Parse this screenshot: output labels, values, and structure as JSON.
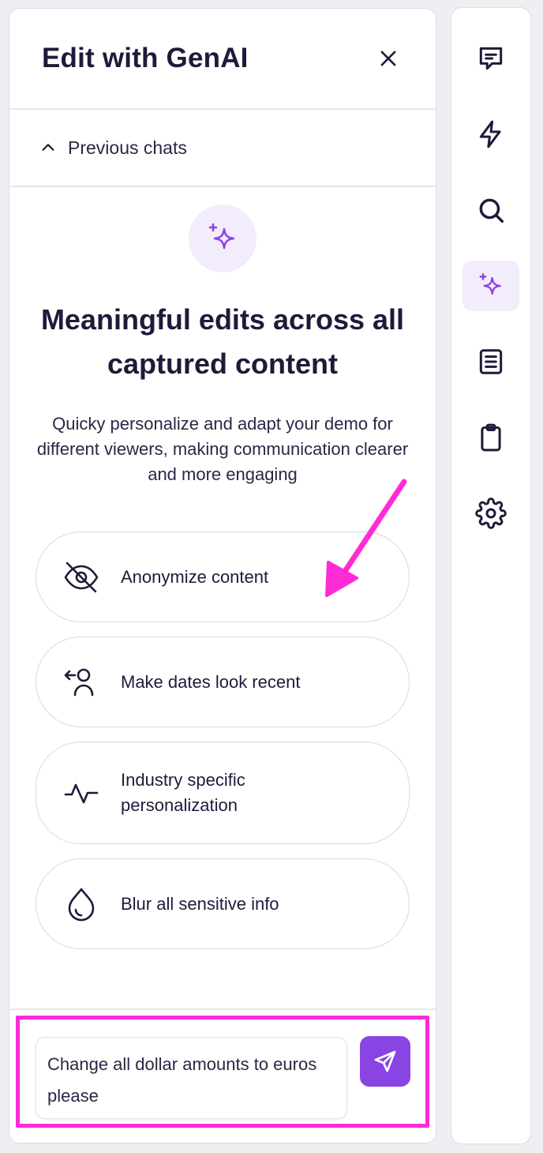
{
  "panel": {
    "title": "Edit with GenAI",
    "previous_chats_label": "Previous chats",
    "hero_title": "Meaningful edits across all captured content",
    "hero_description": "Quicky personalize and adapt your demo for different viewers, making communication clearer and more engaging",
    "options": [
      {
        "label": "Anonymize content",
        "icon": "eye-off-icon"
      },
      {
        "label": "Make dates look recent",
        "icon": "user-arrow-icon"
      },
      {
        "label": "Industry specific personalization",
        "icon": "activity-icon"
      },
      {
        "label": "Blur all sensitive info",
        "icon": "droplet-icon"
      }
    ],
    "prompt_value": "Change all dollar amounts to euros please"
  },
  "rail": {
    "items": [
      "comment-icon",
      "lightning-icon",
      "search-icon",
      "sparkle-icon",
      "document-icon",
      "clipboard-icon",
      "gear-icon"
    ],
    "active": "sparkle-icon"
  },
  "colors": {
    "accent": "#8a44e3",
    "accent_light": "#f2ecfc",
    "highlight": "#ff2bd6",
    "text": "#1f1a3a"
  }
}
